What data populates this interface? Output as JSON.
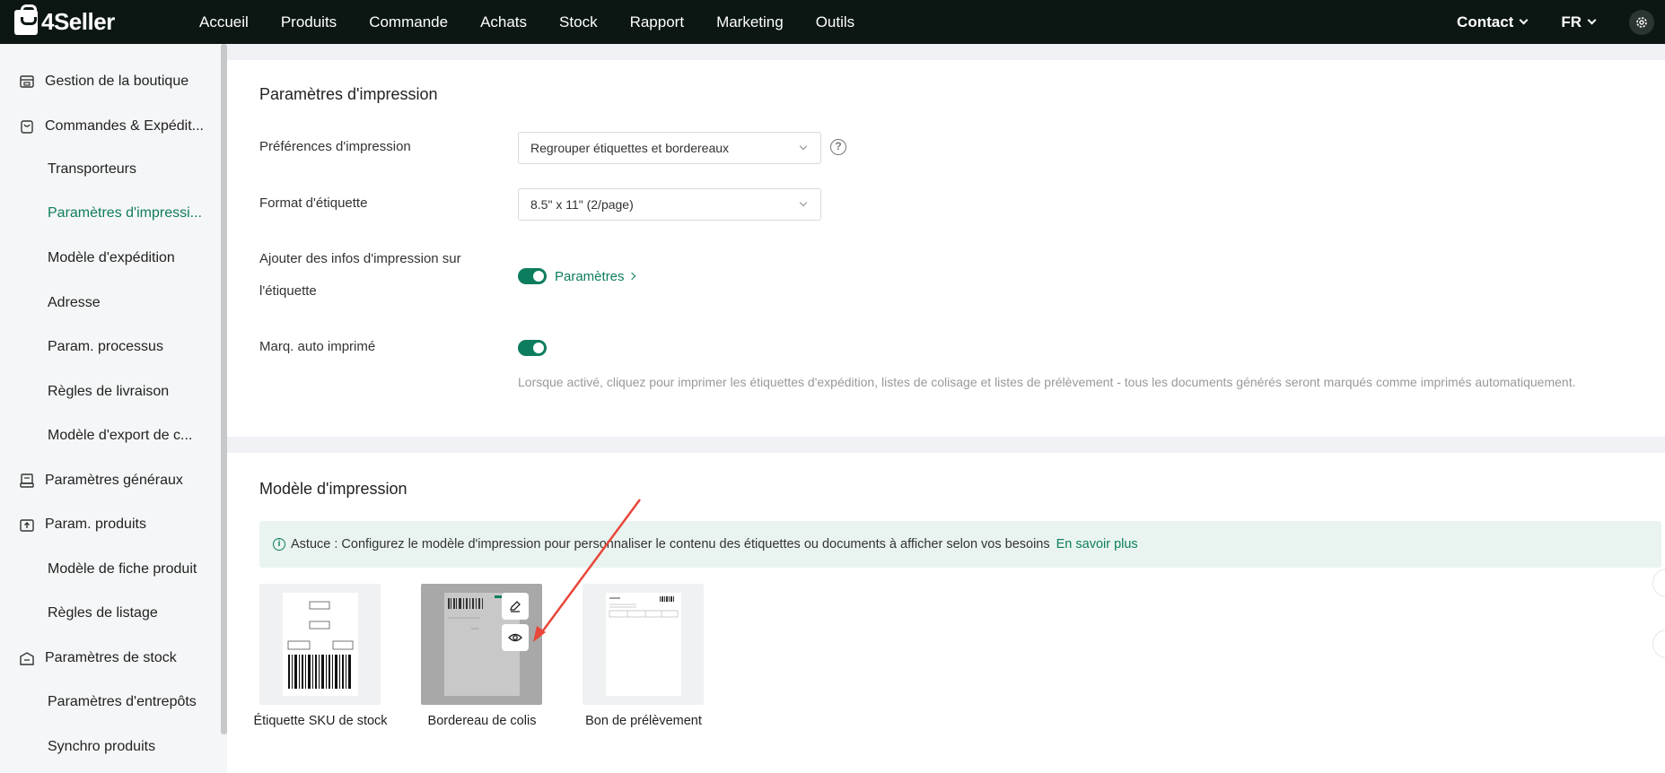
{
  "brand": {
    "name": "4Seller"
  },
  "nav": {
    "items": [
      "Accueil",
      "Produits",
      "Commande",
      "Achats",
      "Stock",
      "Rapport",
      "Marketing",
      "Outils"
    ],
    "contact": "Contact",
    "lang": "FR"
  },
  "sidebar": {
    "items": [
      {
        "label": "Gestion de la boutique",
        "type": "group",
        "icon": "store-icon"
      },
      {
        "label": "Commandes & Expédit...",
        "type": "group",
        "icon": "order-bag-icon"
      },
      {
        "label": "Transporteurs",
        "type": "sub"
      },
      {
        "label": "Paramètres d'impressi...",
        "type": "sub",
        "active": true
      },
      {
        "label": "Modèle d'expédition",
        "type": "sub"
      },
      {
        "label": "Adresse",
        "type": "sub"
      },
      {
        "label": "Param. processus",
        "type": "sub"
      },
      {
        "label": "Règles de livraison",
        "type": "sub"
      },
      {
        "label": "Modèle d'export de c...",
        "type": "sub"
      },
      {
        "label": "Paramètres généraux",
        "type": "group",
        "icon": "printer-settings-icon"
      },
      {
        "label": "Param. produits",
        "type": "group",
        "icon": "upload-box-icon"
      },
      {
        "label": "Modèle de fiche produit",
        "type": "sub"
      },
      {
        "label": "Règles de listage",
        "type": "sub"
      },
      {
        "label": "Paramètres de stock",
        "type": "group",
        "icon": "warehouse-icon"
      },
      {
        "label": "Paramètres d'entrepôts",
        "type": "sub"
      },
      {
        "label": "Synchro produits",
        "type": "sub"
      }
    ]
  },
  "print_settings": {
    "title": "Paramètres d'impression",
    "pref_label": "Préférences d'impression",
    "pref_value": "Regrouper étiquettes et bordereaux",
    "format_label": "Format d'étiquette",
    "format_value": "8.5\" x 11\" (2/page)",
    "add_info_label_line1": "Ajouter des infos d'impression sur",
    "add_info_label_line2": "l'étiquette",
    "add_info_link": "Paramètres",
    "auto_mark_label": "Marq. auto imprimé",
    "auto_mark_desc": "Lorsque activé, cliquez pour imprimer les étiquettes d'expédition, listes de colisage et listes de prélèvement - tous les documents générés seront marqués comme imprimés automatiquement."
  },
  "print_template": {
    "title": "Modèle d'impression",
    "tip": "Astuce : Configurez le modèle d'impression pour personnaliser le contenu des étiquettes ou documents à afficher selon vos besoins",
    "tip_link": "En savoir plus",
    "cards": [
      {
        "label": "Étiquette SKU de stock"
      },
      {
        "label": "Bordereau de colis"
      },
      {
        "label": "Bon de prélèvement"
      }
    ]
  },
  "colors": {
    "accent": "#0e7d5f",
    "topbar": "#0c1714",
    "annotation": "#e8473a"
  }
}
